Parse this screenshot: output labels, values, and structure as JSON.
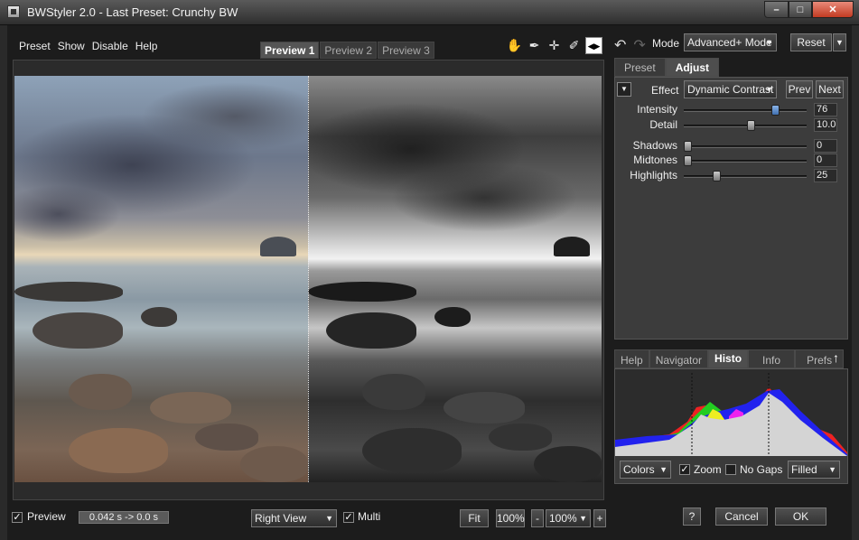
{
  "window": {
    "title": "BWStyler 2.0 - Last Preset: Crunchy BW",
    "minimize_glyph": "–",
    "maximize_glyph": "□",
    "close_glyph": "✕"
  },
  "menu": [
    "Preset",
    "Show",
    "Disable",
    "Help"
  ],
  "preview_tabs": [
    {
      "label": "Preview 1",
      "active": true
    },
    {
      "label": "Preview 2",
      "active": false
    },
    {
      "label": "Preview 3",
      "active": false
    }
  ],
  "tools": [
    {
      "icon": "hand-icon",
      "glyph": "✋",
      "active": false
    },
    {
      "icon": "eyedropper-icon",
      "glyph": "✒",
      "active": false
    },
    {
      "icon": "crosshair-icon",
      "glyph": "✛",
      "active": false
    },
    {
      "icon": "brush-icon",
      "glyph": "✐",
      "active": false
    },
    {
      "icon": "split-view-icon",
      "glyph": "◀▶",
      "active": true
    }
  ],
  "toolbar_right": {
    "undo_glyph": "↶",
    "redo_glyph": "↷",
    "mode_label": "Mode",
    "mode_value": "Advanced+ Mode",
    "reset_label": "Reset",
    "dropdown_glyph": "▼"
  },
  "right_tabs": [
    {
      "label": "Preset",
      "active": false
    },
    {
      "label": "Adjust",
      "active": true
    }
  ],
  "adjust": {
    "collapse_glyph": "▼",
    "effect_label": "Effect",
    "effect_value": "Dynamic Contrast",
    "prev_label": "Prev",
    "next_label": "Next",
    "sliders": [
      {
        "label": "Intensity",
        "value": "76",
        "fraction": 0.76,
        "active": true
      },
      {
        "label": "Detail",
        "value": "10.0",
        "fraction": 0.55,
        "active": false
      },
      {
        "label": "Shadows",
        "value": "0",
        "fraction": 0.0,
        "active": false
      },
      {
        "label": "Midtones",
        "value": "0",
        "fraction": 0.0,
        "active": false
      },
      {
        "label": "Highlights",
        "value": "25",
        "fraction": 0.25,
        "active": false
      }
    ]
  },
  "bottom_tabs": [
    {
      "label": "Help",
      "active": false
    },
    {
      "label": "Navigator",
      "active": false
    },
    {
      "label": "Histo",
      "active": true
    },
    {
      "label": "Info",
      "active": false
    },
    {
      "label": "Prefs",
      "active": false
    }
  ],
  "histo_controls": {
    "up_glyph": "↑",
    "colors_value": "Colors",
    "zoom_label": "Zoom",
    "zoom_checked": true,
    "nogaps_label": "No Gaps",
    "nogaps_checked": false,
    "fill_value": "Filled",
    "check_glyph": "✓"
  },
  "bottom_bar": {
    "preview_label": "Preview",
    "preview_checked": true,
    "timing": "0.042 s -> 0.0 s",
    "view_value": "Right View",
    "multi_label": "Multi",
    "multi_checked": true,
    "fit_label": "Fit",
    "zoom_100": "100%",
    "zoom_minus": "-",
    "zoom_value": "100%",
    "zoom_plus": "+",
    "help_label": "?",
    "cancel_label": "Cancel",
    "ok_label": "OK"
  },
  "colors": {
    "accent_thumb": "#4a7fc4",
    "bg": "#1c1c1c"
  }
}
